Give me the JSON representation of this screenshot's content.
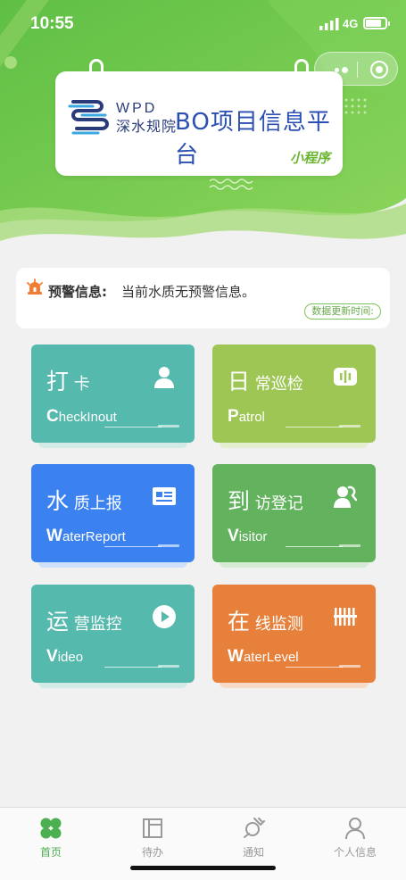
{
  "status_bar": {
    "time": "10:55",
    "network": "4G"
  },
  "banner": {
    "logo_en": "WPD",
    "logo_cn": "深水规院",
    "title": "BO项目信息平台",
    "subtitle": "小程序"
  },
  "alert": {
    "label": "预警信息:",
    "message": "当前水质无预警信息。",
    "update_label": "数据更新时间:"
  },
  "tiles": [
    {
      "cn_first": "打",
      "cn_rest": "卡",
      "en_first": "C",
      "en_rest": "heckInout",
      "icon": "person-icon",
      "color": "#56b9ad"
    },
    {
      "cn_first": "日",
      "cn_rest": "常巡检",
      "en_first": "P",
      "en_rest": "atrol",
      "icon": "audio-wave-icon",
      "color": "#9ec655"
    },
    {
      "cn_first": "水",
      "cn_rest": "质上报",
      "en_first": "W",
      "en_rest": "aterReport",
      "icon": "id-card-icon",
      "color": "#3b82f0"
    },
    {
      "cn_first": "到",
      "cn_rest": "访登记",
      "en_first": "V",
      "en_rest": "isitor",
      "icon": "visitor-icon",
      "color": "#62b25e"
    },
    {
      "cn_first": "运",
      "cn_rest": "营监控",
      "en_first": "V",
      "en_rest": "ideo",
      "icon": "play-icon",
      "color": "#56b9ad"
    },
    {
      "cn_first": "在",
      "cn_rest": "线监测",
      "en_first": "W",
      "en_rest": "aterLevel",
      "icon": "level-bars-icon",
      "color": "#e6803a"
    }
  ],
  "tabbar": {
    "items": [
      {
        "label": "首页",
        "icon": "home-clover-icon",
        "active": true
      },
      {
        "label": "待办",
        "icon": "todo-layout-icon",
        "active": false
      },
      {
        "label": "通知",
        "icon": "notification-icon",
        "active": false
      },
      {
        "label": "个人信息",
        "icon": "profile-icon",
        "active": false
      }
    ]
  },
  "colors": {
    "primary_green": "#4caf50",
    "header_green": "#6cc24a",
    "alert_orange": "#ef7d33"
  }
}
